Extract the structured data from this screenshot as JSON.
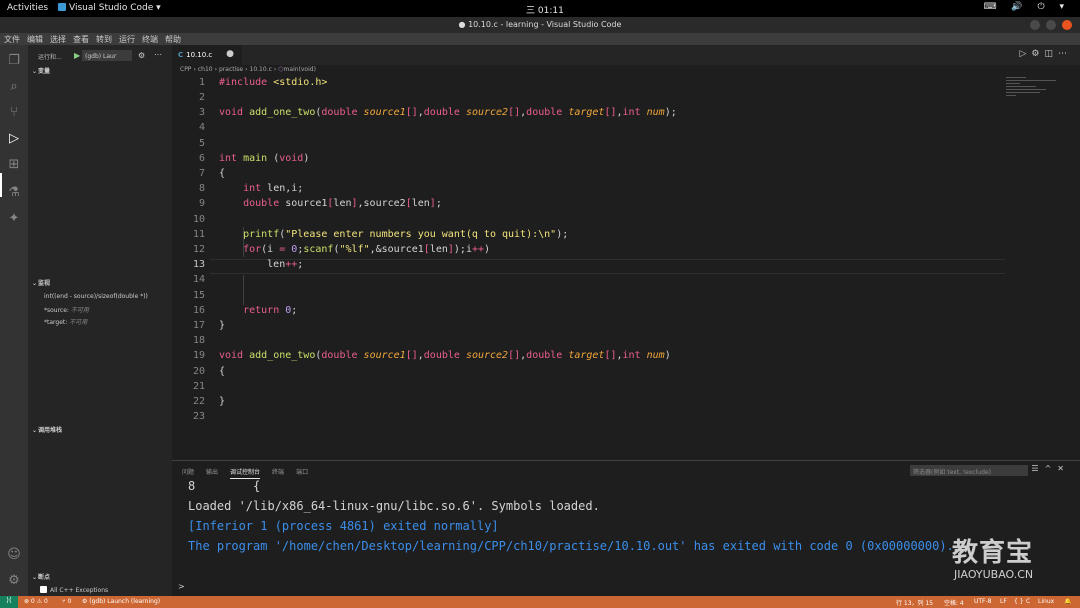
{
  "gnome": {
    "activities": "Activities",
    "app_menu": "Visual Studio Code ▾",
    "clock": "三 01:11",
    "tray": "⌨ 🔊 ⏻ ▾"
  },
  "window": {
    "title": "● 10.10.c - learning - Visual Studio Code"
  },
  "menu": [
    "文件",
    "编辑",
    "选择",
    "查看",
    "转到",
    "运行",
    "终端",
    "帮助"
  ],
  "sidebar": {
    "run_title": "运行和...",
    "config": "(gdb) Laur",
    "variables_header": "变量",
    "watch_header": "监视",
    "watch": [
      {
        "expr": "int((end - source)/sizeof(double *))",
        "value": ""
      },
      {
        "expr": "*source:",
        "value": "不可用"
      },
      {
        "expr": "*target:",
        "value": "不可用"
      }
    ],
    "callstack_header": "调用堆栈",
    "breakpoints_header": "断点",
    "breakpoint_item": "All C++ Exceptions"
  },
  "editor": {
    "tab_label": "10.10.c",
    "tab_dot": "●",
    "breadcrumb": [
      "CPP",
      "ch10",
      "practise",
      "10.10.c",
      "main(void)"
    ],
    "lines": [
      "1",
      "2",
      "3",
      "4",
      "5",
      "6",
      "7",
      "8",
      "9",
      "10",
      "11",
      "12",
      "13",
      "14",
      "15",
      "16",
      "17",
      "18",
      "19",
      "20",
      "21",
      "22",
      "23"
    ],
    "current_line": "13"
  },
  "panel": {
    "tabs": [
      "问题",
      "输出",
      "调试控制台",
      "终端",
      "端口"
    ],
    "active_tab": "调试控制台",
    "filter_placeholder": "筛选器(例如 text, !exclude)",
    "output": [
      {
        "text": "8        {",
        "color": "white"
      },
      {
        "text": "Loaded '/lib/x86_64-linux-gnu/libc.so.6'. Symbols loaded.",
        "color": "white"
      },
      {
        "text": "[Inferior 1 (process 4861) exited normally]",
        "color": "blue"
      },
      {
        "text": "The program '/home/chen/Desktop/learning/CPP/ch10/practise/10.10.out' has exited with code 0 (0x00000000).",
        "color": "blue"
      }
    ],
    "prompt": ">"
  },
  "statusbar": {
    "errors": "⊗ 0 ⚠ 0",
    "ports": "⑂ 0",
    "launch": "⚙ (gdb) Launch (learning)",
    "position": "行 13，列 15",
    "spaces": "空格: 4",
    "encoding": "UTF-8",
    "eol": "LF",
    "language_braces": "{ }",
    "language": "C",
    "os": "Linux",
    "bell": "🔔"
  },
  "watermark": {
    "main": "教育宝",
    "sub": "JIAOYUBAO.CN"
  },
  "colors": {
    "statusbar": "#cc6633",
    "keyword": "#ec5f8e",
    "function": "#c8e06a",
    "param": "#f2a73b",
    "string": "#f1e37c",
    "number": "#c19ef0",
    "console_blue": "#3b8eea"
  }
}
